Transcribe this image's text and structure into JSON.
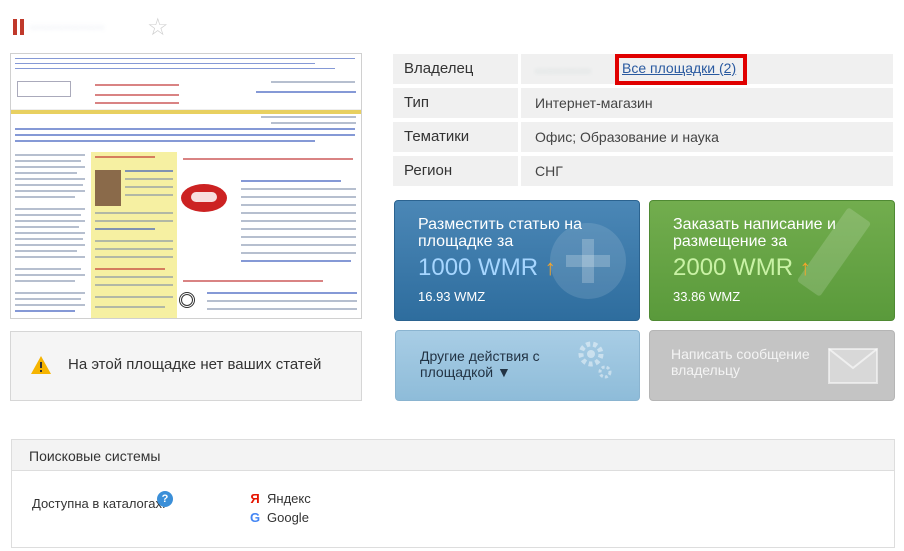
{
  "header": {
    "site_name": "··············",
    "star_glyph": "☆"
  },
  "info": {
    "rows": [
      {
        "label": "Владелец",
        "value": ""
      },
      {
        "label": "Тип",
        "value": "Интернет-магазин"
      },
      {
        "label": "Тематики",
        "value": "Офис; Образование и наука"
      },
      {
        "label": "Регион",
        "value": "СНГ"
      }
    ],
    "owner_blurred": "············",
    "all_sites_link": "Все площадки (2)"
  },
  "warning": {
    "text": "На этой площадке нет ваших статей"
  },
  "actions": {
    "place_article": {
      "title": "Разместить статью на площадке за",
      "price": "1000 WMR",
      "price_sub": "16.93 WMZ"
    },
    "order_writing": {
      "title": "Заказать написание и размещение за",
      "price": "2000 WMR",
      "price_sub": "33.86 WMZ"
    },
    "other_actions": {
      "title": "Другие действия с площадкой ▼"
    },
    "message_owner": {
      "title": "Написать сообщение владельцу"
    },
    "arrow_glyph": "↑"
  },
  "search": {
    "title": "Поисковые системы",
    "available_label": "Доступна в каталогах:",
    "help_glyph": "?",
    "engines": [
      {
        "name": "Яндекс",
        "icon": "yandex-icon",
        "glyph": "Я",
        "color": "#e61400"
      },
      {
        "name": "Google",
        "icon": "google-icon",
        "glyph": "G",
        "color": "#4285f4"
      }
    ]
  },
  "colors": {
    "highlight": "#e00000",
    "link": "#2a5aa0",
    "blue_button": "#3a7aab",
    "green_button": "#67a446"
  }
}
